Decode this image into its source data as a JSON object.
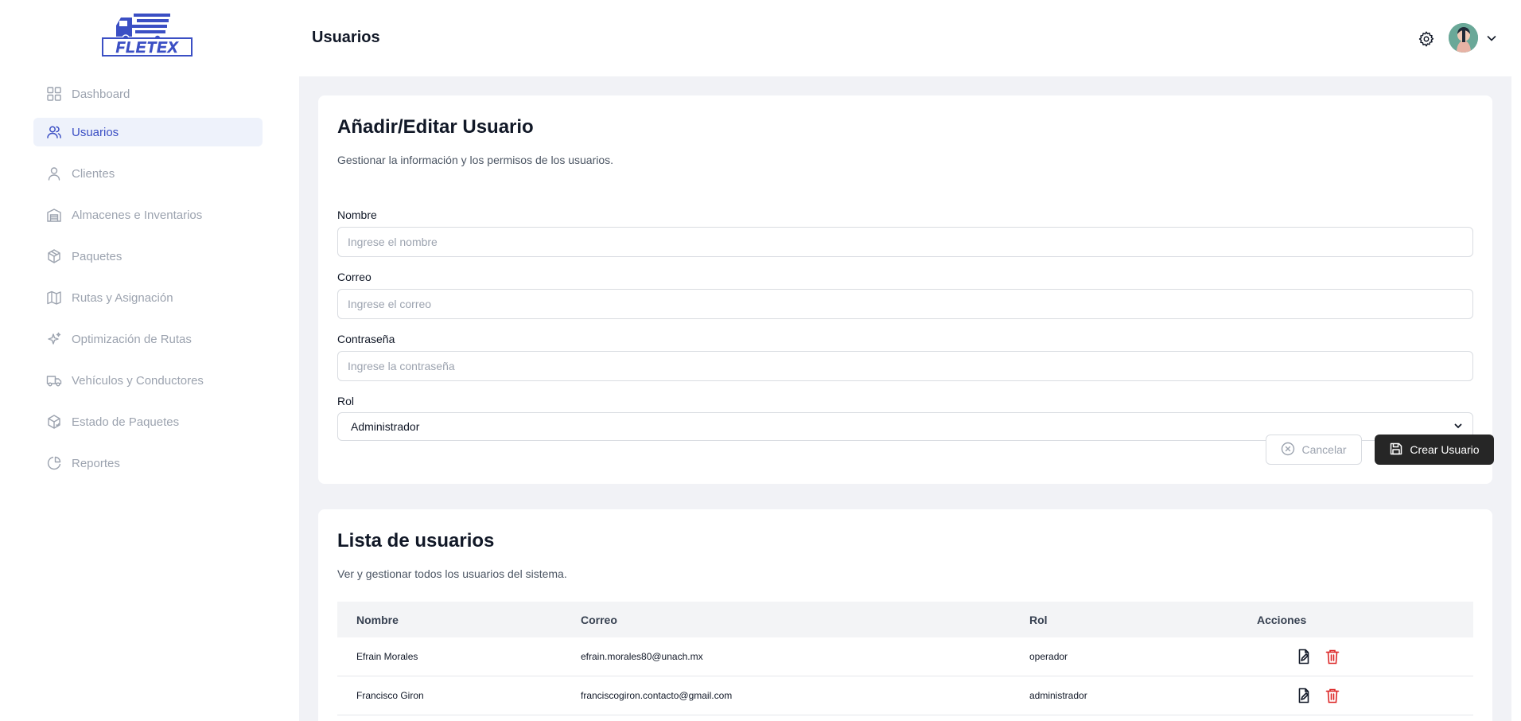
{
  "brand": {
    "logo_text": "FLETEX",
    "logo_color": "#3b4fc4"
  },
  "sidebar": {
    "items": [
      {
        "label": "Dashboard",
        "icon": "dashboard-grid-icon",
        "active": false
      },
      {
        "label": "Usuarios",
        "icon": "users-icon",
        "active": true
      },
      {
        "label": "Clientes",
        "icon": "user-icon",
        "active": false
      },
      {
        "label": "Almacenes e Inventarios",
        "icon": "warehouse-icon",
        "active": false
      },
      {
        "label": "Paquetes",
        "icon": "package-icon",
        "active": false
      },
      {
        "label": "Rutas y Asignación",
        "icon": "map-icon",
        "active": false
      },
      {
        "label": "Optimización de Rutas",
        "icon": "sparkles-icon",
        "active": false
      },
      {
        "label": "Vehículos y Conductores",
        "icon": "truck-icon",
        "active": false
      },
      {
        "label": "Estado de Paquetes",
        "icon": "package-check-icon",
        "active": false
      },
      {
        "label": "Reportes",
        "icon": "pie-chart-icon",
        "active": false
      }
    ]
  },
  "header": {
    "title": "Usuarios",
    "settings_icon": "gear-icon",
    "avatar_icon": "avatar",
    "menu_icon": "chevron-down-icon"
  },
  "form": {
    "title": "Añadir/Editar Usuario",
    "description": "Gestionar la información y los permisos de los usuarios.",
    "fields": {
      "name": {
        "label": "Nombre",
        "placeholder": "Ingrese el nombre",
        "value": ""
      },
      "email": {
        "label": "Correo",
        "placeholder": "Ingrese el correo",
        "value": ""
      },
      "password": {
        "label": "Contraseña",
        "placeholder": "Ingrese la contraseña",
        "value": ""
      },
      "role": {
        "label": "Rol",
        "value": "Administrador"
      }
    },
    "cancel_label": "Cancelar",
    "create_label": "Crear Usuario"
  },
  "list": {
    "title": "Lista de usuarios",
    "description": "Ver y gestionar todos los usuarios del sistema.",
    "columns": [
      "Nombre",
      "Correo",
      "Rol",
      "Acciones"
    ],
    "rows": [
      {
        "name": "Efrain Morales",
        "email": "efrain.morales80@unach.mx",
        "role": "operador"
      },
      {
        "name": "Francisco Giron",
        "email": "franciscogiron.contacto@gmail.com",
        "role": "administrador"
      }
    ]
  },
  "colors": {
    "accent": "#3b4fc4",
    "danger": "#dc2626",
    "dark_button": "#262626",
    "background": "#f1f2f6"
  }
}
